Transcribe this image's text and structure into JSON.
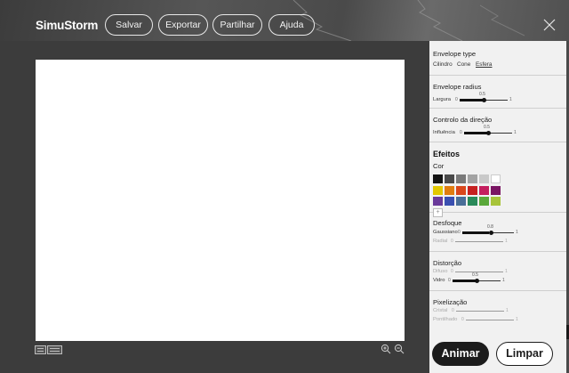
{
  "app": {
    "name": "SimuStorm"
  },
  "toolbar": {
    "save": "Salvar",
    "export": "Exportar",
    "share": "Partilhar",
    "help": "Ajuda"
  },
  "envelope_type": {
    "title": "Envelope type",
    "options": [
      "Cilindro",
      "Cone",
      "Esfera"
    ],
    "selected": "Esfera"
  },
  "envelope_radius": {
    "title": "Envelope radius",
    "slider": {
      "label": "Largura",
      "min": "0",
      "max": "1",
      "value": "0.5"
    }
  },
  "direction": {
    "title": "Controlo da direção",
    "slider": {
      "label": "Influência",
      "min": "0",
      "max": "1",
      "value": "0.5"
    }
  },
  "effects": {
    "title": "Efeitos",
    "color_label": "Cor",
    "swatches": [
      "#141414",
      "#4a4a4a",
      "#7a7a7a",
      "#a3a3a3",
      "#c9c9c9",
      "#ffffff",
      "#e2c800",
      "#e07d10",
      "#d9471c",
      "#c62020",
      "#c41e5e",
      "#7a1563",
      "#6a3a9a",
      "#3a4fb0",
      "#4a6f98",
      "#2a8a5a",
      "#5aa83a",
      "#a8c43a"
    ],
    "add_symbol": "+"
  },
  "blur": {
    "title": "Desfoque",
    "sliders": [
      {
        "label": "Gaussiano",
        "min": "0",
        "max": "1",
        "value": "0.8",
        "active": true
      },
      {
        "label": "Radial",
        "min": "0",
        "max": "1",
        "value": "0",
        "active": false
      }
    ]
  },
  "distortion": {
    "title": "Distorção",
    "sliders": [
      {
        "label": "Difuso",
        "min": "0",
        "max": "1",
        "value": "0",
        "active": false
      },
      {
        "label": "Vidro",
        "min": "0",
        "max": "1",
        "value": "0.5",
        "active": true
      }
    ]
  },
  "pixelation": {
    "title": "Pixelização",
    "sliders": [
      {
        "label": "Cristal",
        "min": "0",
        "max": "1",
        "value": "0",
        "active": false
      },
      {
        "label": "Pontilhado",
        "min": "0",
        "max": "1",
        "value": "0",
        "active": false
      }
    ]
  },
  "actions": {
    "animate": "Animar",
    "clear": "Limpar"
  },
  "icons": [
    "close-icon",
    "list-view-icon",
    "grid-view-icon",
    "zoom-in-icon",
    "zoom-out-icon"
  ]
}
